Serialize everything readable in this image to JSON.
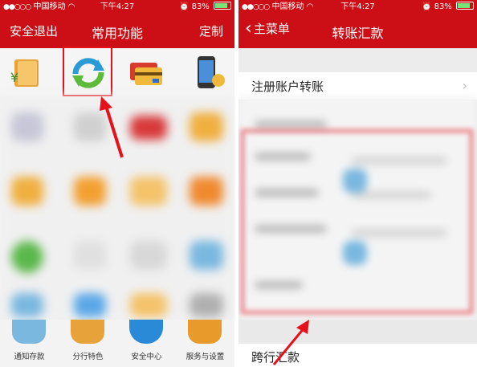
{
  "left": {
    "status": {
      "carrier": "中国移动",
      "time": "下午4:27",
      "battery": "83%",
      "battery_level": 0.83
    },
    "nav": {
      "left": "安全退出",
      "title": "常用功能",
      "right": "定制"
    },
    "top_icons": [
      "wallet-icon",
      "transfer-refresh-icon",
      "bank-cards-icon",
      "mobile-phone-icon"
    ],
    "bottom_items": [
      {
        "label": "通知存款",
        "icon": "piggy-bank-icon"
      },
      {
        "label": "分行特色",
        "icon": "branch-feature-icon"
      },
      {
        "label": "安全中心",
        "icon": "shield-icon"
      },
      {
        "label": "服务与设置",
        "icon": "gear-icon"
      }
    ]
  },
  "right": {
    "status": {
      "carrier": "中国移动",
      "time": "下午4:27",
      "battery": "83%",
      "battery_level": 0.83
    },
    "nav": {
      "back": "主菜单",
      "title": "转账汇款"
    },
    "rows": {
      "registered_transfer": "注册账户转账",
      "cross_bank": "跨行汇款"
    }
  },
  "colors": {
    "brand_red": "#cc0f16",
    "highlight_red": "#e5121b"
  }
}
